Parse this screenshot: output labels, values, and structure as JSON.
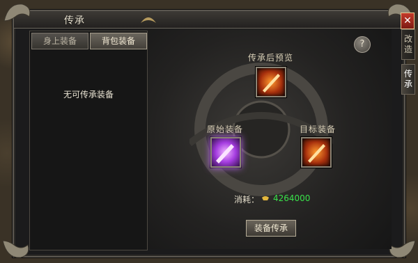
{
  "window": {
    "title": "传承"
  },
  "close": {
    "label": "✕"
  },
  "side_tabs": [
    {
      "label": "改造"
    },
    {
      "label": "传承"
    }
  ],
  "left_panel": {
    "tabs": [
      {
        "label": "身上装备",
        "active": false
      },
      {
        "label": "背包装备",
        "active": true
      }
    ],
    "empty_text": "无可传承装备"
  },
  "inherit": {
    "preview_label": "传承后预览",
    "source_label": "原始装备",
    "target_label": "目标装备",
    "cost_label": "消耗：",
    "cost_value": "4264000",
    "button_label": "装备传承",
    "help_label": "?"
  },
  "colors": {
    "cost": "#39e24a",
    "title": "#e9e2d0"
  },
  "icons": [
    "dragon-ornament-icon",
    "gold-ingot-icon",
    "sword-icon",
    "help-icon",
    "close-icon"
  ]
}
